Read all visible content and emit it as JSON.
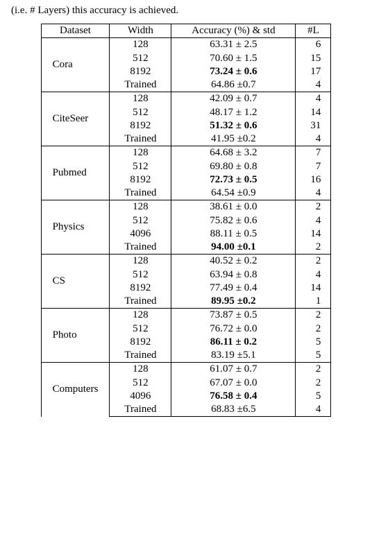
{
  "caption_fragment": "(i.e. # Layers) this accuracy is achieved.",
  "headers": {
    "dataset": "Dataset",
    "width": "Width",
    "acc": "Accuracy (%) & std",
    "layers": "#L"
  },
  "groups": [
    {
      "name": "Cora",
      "rows": [
        {
          "width": "128",
          "acc": "63.31 ± 2.5",
          "bold": false,
          "layers": "6"
        },
        {
          "width": "512",
          "acc": "70.60 ± 1.5",
          "bold": false,
          "layers": "15"
        },
        {
          "width": "8192",
          "acc": "73.24 ± 0.6",
          "bold": true,
          "layers": "17"
        },
        {
          "width": "Trained",
          "acc": "64.86 ±0.7",
          "bold": false,
          "layers": "4"
        }
      ]
    },
    {
      "name": "CiteSeer",
      "rows": [
        {
          "width": "128",
          "acc": "42.09 ± 0.7",
          "bold": false,
          "layers": "4"
        },
        {
          "width": "512",
          "acc": "48.17 ± 1.2",
          "bold": false,
          "layers": "14"
        },
        {
          "width": "8192",
          "acc": "51.32 ± 0.6",
          "bold": true,
          "layers": "31"
        },
        {
          "width": "Trained",
          "acc": "41.95 ±0.2",
          "bold": false,
          "layers": "4"
        }
      ]
    },
    {
      "name": "Pubmed",
      "rows": [
        {
          "width": "128",
          "acc": "64.68 ± 3.2",
          "bold": false,
          "layers": "7"
        },
        {
          "width": "512",
          "acc": "69.80 ± 0.8",
          "bold": false,
          "layers": "7"
        },
        {
          "width": "8192",
          "acc": "72.73 ± 0.5",
          "bold": true,
          "layers": "16"
        },
        {
          "width": "Trained",
          "acc": "64.54 ±0.9",
          "bold": false,
          "layers": "4"
        }
      ]
    },
    {
      "name": "Physics",
      "rows": [
        {
          "width": "128",
          "acc": "38.61 ± 0.0",
          "bold": false,
          "layers": "2"
        },
        {
          "width": "512",
          "acc": "75.82 ± 0.6",
          "bold": false,
          "layers": "4"
        },
        {
          "width": "4096",
          "acc": "88.11 ± 0.5",
          "bold": false,
          "layers": "14"
        },
        {
          "width": "Trained",
          "acc": "94.00 ±0.1",
          "bold": true,
          "layers": "2"
        }
      ]
    },
    {
      "name": "CS",
      "rows": [
        {
          "width": "128",
          "acc": "40.52 ± 0.2",
          "bold": false,
          "layers": "2"
        },
        {
          "width": "512",
          "acc": "63.94 ± 0.8",
          "bold": false,
          "layers": "4"
        },
        {
          "width": "8192",
          "acc": "77.49 ± 0.4",
          "bold": false,
          "layers": "14"
        },
        {
          "width": "Trained",
          "acc": "89.95 ±0.2",
          "bold": true,
          "layers": "1"
        }
      ]
    },
    {
      "name": "Photo",
      "rows": [
        {
          "width": "128",
          "acc": "73.87 ± 0.5",
          "bold": false,
          "layers": "2"
        },
        {
          "width": "512",
          "acc": "76.72 ± 0.0",
          "bold": false,
          "layers": "2"
        },
        {
          "width": "8192",
          "acc": "86.11 ± 0.2",
          "bold": true,
          "layers": "5"
        },
        {
          "width": "Trained",
          "acc": "83.19 ±5.1",
          "bold": false,
          "layers": "5"
        }
      ]
    },
    {
      "name": "Computers",
      "rows": [
        {
          "width": "128",
          "acc": "61.07 ± 0.7",
          "bold": false,
          "layers": "2"
        },
        {
          "width": "512",
          "acc": "67.07 ± 0.0",
          "bold": false,
          "layers": "2"
        },
        {
          "width": "4096",
          "acc": "76.58 ± 0.4",
          "bold": true,
          "layers": "5"
        },
        {
          "width": "Trained",
          "acc": "68.83 ±6.5",
          "bold": false,
          "layers": "4"
        }
      ]
    }
  ],
  "chart_data": {
    "type": "table",
    "columns": [
      "Dataset",
      "Width",
      "Accuracy (%) & std",
      "#L"
    ],
    "rows": [
      [
        "Cora",
        "128",
        "63.31 ± 2.5",
        6
      ],
      [
        "Cora",
        "512",
        "70.60 ± 1.5",
        15
      ],
      [
        "Cora",
        "8192",
        "73.24 ± 0.6",
        17
      ],
      [
        "Cora",
        "Trained",
        "64.86 ± 0.7",
        4
      ],
      [
        "CiteSeer",
        "128",
        "42.09 ± 0.7",
        4
      ],
      [
        "CiteSeer",
        "512",
        "48.17 ± 1.2",
        14
      ],
      [
        "CiteSeer",
        "8192",
        "51.32 ± 0.6",
        31
      ],
      [
        "CiteSeer",
        "Trained",
        "41.95 ± 0.2",
        4
      ],
      [
        "Pubmed",
        "128",
        "64.68 ± 3.2",
        7
      ],
      [
        "Pubmed",
        "512",
        "69.80 ± 0.8",
        7
      ],
      [
        "Pubmed",
        "8192",
        "72.73 ± 0.5",
        16
      ],
      [
        "Pubmed",
        "Trained",
        "64.54 ± 0.9",
        4
      ],
      [
        "Physics",
        "128",
        "38.61 ± 0.0",
        2
      ],
      [
        "Physics",
        "512",
        "75.82 ± 0.6",
        4
      ],
      [
        "Physics",
        "4096",
        "88.11 ± 0.5",
        14
      ],
      [
        "Physics",
        "Trained",
        "94.00 ± 0.1",
        2
      ],
      [
        "CS",
        "128",
        "40.52 ± 0.2",
        2
      ],
      [
        "CS",
        "512",
        "63.94 ± 0.8",
        4
      ],
      [
        "CS",
        "8192",
        "77.49 ± 0.4",
        14
      ],
      [
        "CS",
        "Trained",
        "89.95 ± 0.2",
        1
      ],
      [
        "Photo",
        "128",
        "73.87 ± 0.5",
        2
      ],
      [
        "Photo",
        "512",
        "76.72 ± 0.0",
        2
      ],
      [
        "Photo",
        "8192",
        "86.11 ± 0.2",
        5
      ],
      [
        "Photo",
        "Trained",
        "83.19 ± 5.1",
        5
      ],
      [
        "Computers",
        "128",
        "61.07 ± 0.7",
        2
      ],
      [
        "Computers",
        "512",
        "67.07 ± 0.0",
        2
      ],
      [
        "Computers",
        "4096",
        "76.58 ± 0.4",
        5
      ],
      [
        "Computers",
        "Trained",
        "68.83 ± 6.5",
        4
      ]
    ]
  }
}
